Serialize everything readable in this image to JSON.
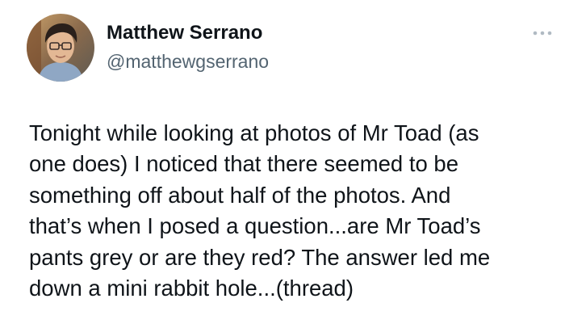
{
  "author": {
    "display_name": "Matthew Serrano",
    "handle": "@matthewgserrano"
  },
  "tweet": {
    "lines": [
      "Tonight while looking at photos of Mr Toad (as",
      "one does) I noticed that there seemed to be",
      "something off about half of the photos. And",
      "that’s when I posed a question...are Mr Toad’s",
      "pants grey or are they red? The answer led me",
      "down a mini rabbit hole...(thread)"
    ]
  },
  "icons": {
    "more": "more-horizontal-icon",
    "avatar": "avatar"
  },
  "colors": {
    "primary_text": "#0f1419",
    "secondary_text": "#536471",
    "more_icon": "#b0bac3",
    "background": "#ffffff"
  }
}
